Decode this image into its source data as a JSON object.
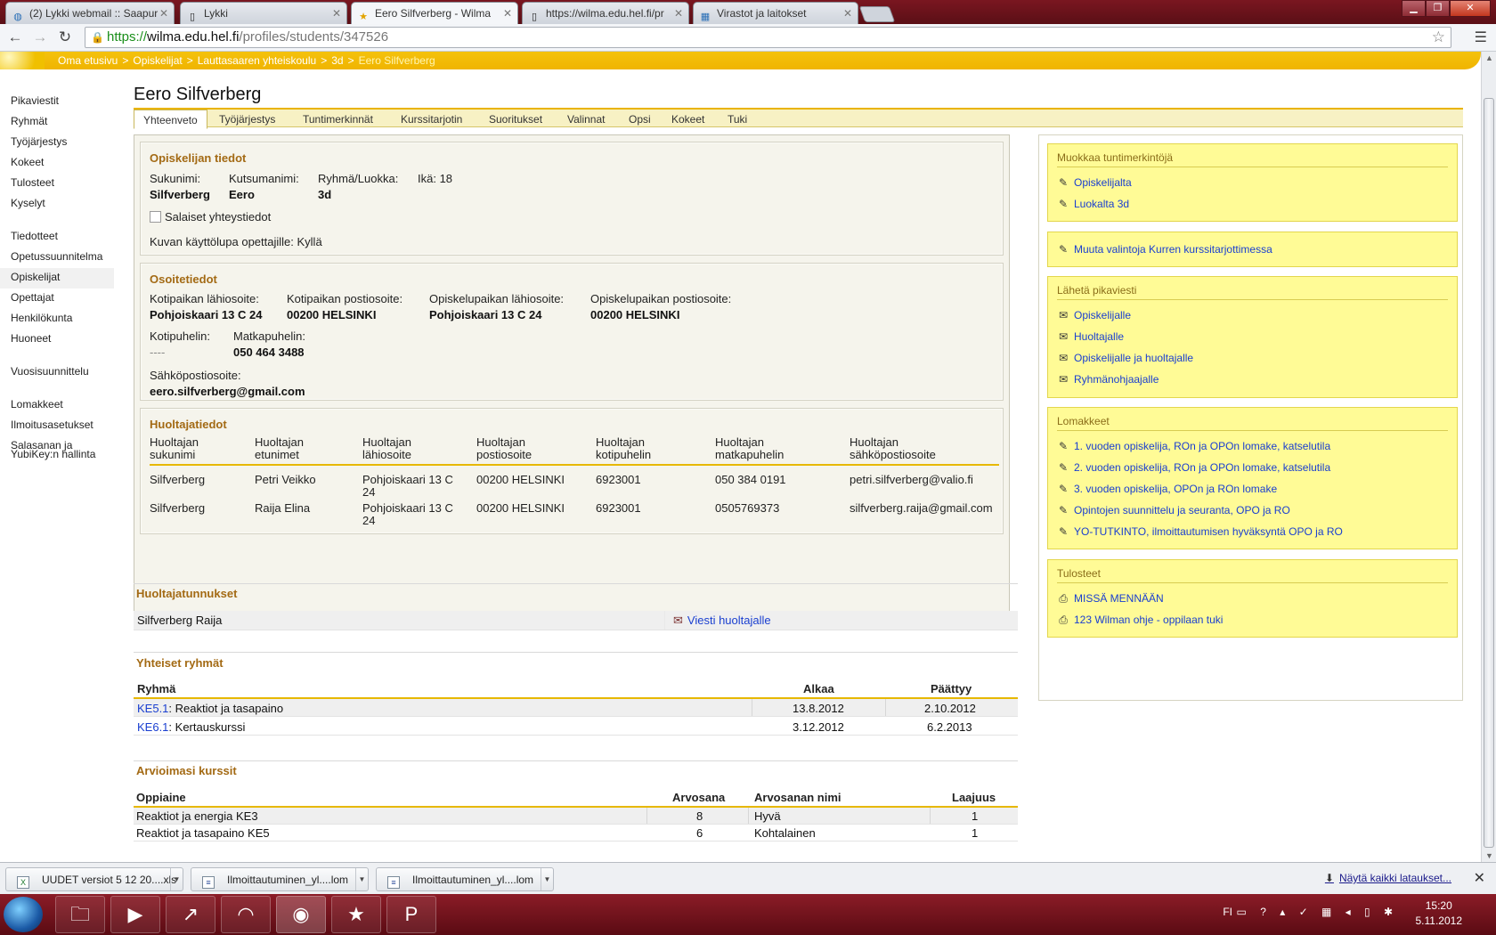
{
  "browser": {
    "tabs": [
      {
        "label": "(2) Lykki webmail :: Saapur",
        "icon": "globe"
      },
      {
        "label": "Lykki",
        "icon": "page"
      },
      {
        "label": "Eero Silfverberg - Wilma",
        "icon": "star"
      },
      {
        "label": "https://wilma.edu.hel.fi/pr",
        "icon": "page"
      },
      {
        "label": "Virastot ja laitokset",
        "icon": "map"
      }
    ],
    "url_scheme": "https://",
    "url_host": "wilma.edu.hel.fi",
    "url_path": "/profiles/students/347526"
  },
  "breadcrumb": [
    "Oma etusivu",
    "Opiskelijat",
    "Lauttasaaren yhteiskoulu",
    "3d",
    "Eero Silfverberg"
  ],
  "sidebar": {
    "groups": [
      [
        "Pikaviestit",
        "Ryhmät",
        "Työjärjestys",
        "Kokeet",
        "Tulosteet",
        "Kyselyt"
      ],
      [
        "Tiedotteet",
        "Opetussuunnitelma",
        "Opiskelijat",
        "Opettajat",
        "Henkilökunta",
        "Huoneet"
      ],
      [
        "Vuosisuunnittelu"
      ],
      [
        "Lomakkeet",
        "Ilmoitusasetukset",
        "Salasanan ja",
        "YubiKey:n hallinta"
      ]
    ]
  },
  "title": "Eero Silfverberg",
  "tabs": [
    "Yhteenveto",
    "Työjärjestys",
    "Tuntimerkinnät",
    "Kurssitarjotin",
    "Suoritukset",
    "Valinnat",
    "Opsi",
    "Kokeet",
    "Tuki"
  ],
  "student": {
    "heading": "Opiskelijan tiedot",
    "surname_label": "Sukunimi:",
    "surname": "Silfverberg",
    "callname_label": "Kutsumanimi:",
    "callname": "Eero",
    "group_label": "Ryhmä/Luokka:",
    "group": "3d",
    "age": "Ikä: 18",
    "secret_contact": "Salaiset yhteystiedot",
    "photo_permission": "Kuvan käyttölupa opettajille: Kyllä"
  },
  "address": {
    "heading": "Osoitetiedot",
    "home_street_label": "Kotipaikan lähiosoite:",
    "home_street": "Pohjoiskaari 13 C 24",
    "home_postal_label": "Kotipaikan postiosoite:",
    "home_postal": "00200 HELSINKI",
    "study_street_label": "Opiskelupaikan lähiosoite:",
    "study_street": "Pohjoiskaari 13 C 24",
    "study_postal_label": "Opiskelupaikan postiosoite:",
    "study_postal": "00200 HELSINKI",
    "home_phone_label": "Kotipuhelin:",
    "home_phone": "----",
    "mobile_label": "Matkapuhelin:",
    "mobile": "050 464 3488",
    "email_label": "Sähköpostiosoite:",
    "email": "eero.silfverberg@gmail.com"
  },
  "guardians": {
    "heading": "Huoltajatiedot",
    "columns": [
      [
        "Huoltajan",
        "sukunimi"
      ],
      [
        "Huoltajan",
        "etunimet"
      ],
      [
        "Huoltajan",
        "lähiosoite"
      ],
      [
        "Huoltajan",
        "postiosoite"
      ],
      [
        "Huoltajan",
        "kotipuhelin"
      ],
      [
        "Huoltajan",
        "matkapuhelin"
      ],
      [
        "Huoltajan",
        "sähköpostiosoite"
      ]
    ],
    "rows": [
      [
        "Silfverberg",
        "Petri Veikko",
        "Pohjoiskaari 13 C",
        "24",
        "00200 HELSINKI",
        "6923001",
        "050 384 0191",
        "petri.silfverberg@valio.fi"
      ],
      [
        "Silfverberg",
        "Raija Elina",
        "Pohjoiskaari 13 C",
        "24",
        "00200 HELSINKI",
        "6923001",
        "0505769373",
        "silfverberg.raija@gmail.com"
      ]
    ]
  },
  "guardian_accounts": {
    "heading": "Huoltajatunnukset",
    "name": "Silfverberg Raija",
    "message_link": "Viesti huoltajalle"
  },
  "common_groups": {
    "heading": "Yhteiset ryhmät",
    "col_group": "Ryhmä",
    "col_start": "Alkaa",
    "col_end": "Päättyy",
    "rows": [
      {
        "code": "KE5.1",
        "name": ": Reaktiot ja tasapaino",
        "start": "13.8.2012",
        "end": "2.10.2012"
      },
      {
        "code": "KE6.1",
        "name": ": Kertauskurssi",
        "start": "3.12.2012",
        "end": "6.2.2013"
      }
    ]
  },
  "graded_courses": {
    "heading": "Arvioimasi kurssit",
    "col_subject": "Oppiaine",
    "col_grade": "Arvosana",
    "col_grade_name": "Arvosanan nimi",
    "col_scope": "Laajuus",
    "rows": [
      {
        "subject": "Reaktiot ja energia KE3",
        "grade": "8",
        "grade_name": "Hyvä",
        "scope": "1"
      },
      {
        "subject": "Reaktiot ja tasapaino KE5",
        "grade": "6",
        "grade_name": "Kohtalainen",
        "scope": "1"
      }
    ]
  },
  "right_panel": {
    "edit_marks": {
      "heading": "Muokkaa tuntimerkintöjä",
      "links": [
        "Opiskelijalta",
        "Luokalta 3d"
      ]
    },
    "change_choices": "Muuta valintoja Kurren kurssitarjottimessa",
    "send_message": {
      "heading": "Lähetä pikaviesti",
      "links": [
        "Opiskelijalle",
        "Huoltajalle",
        "Opiskelijalle ja huoltajalle",
        "Ryhmänohjaajalle"
      ]
    },
    "forms": {
      "heading": "Lomakkeet",
      "links": [
        "1. vuoden opiskelija, ROn ja OPOn lomake, katselutila",
        "2. vuoden opiskelija, ROn ja OPOn lomake, katselutila",
        "3. vuoden opiskelija, OPOn ja ROn lomake",
        "Opintojen suunnittelu ja seuranta, OPO ja RO",
        "YO-TUTKINTO, ilmoittautumisen hyväksyntä OPO ja RO"
      ]
    },
    "printouts": {
      "heading": "Tulosteet",
      "links": [
        "MISSÄ MENNÄÄN",
        "123 Wilman ohje - oppilaan tuki"
      ]
    }
  },
  "downloads": {
    "items": [
      "UUDET versiot 5 12 20....xls",
      "Ilmoittautuminen_yl....lom",
      "Ilmoittautuminen_yl....lom"
    ],
    "show_all": "Näytä kaikki lataukset..."
  },
  "taskbar": {
    "lang": "FI",
    "time": "15:20",
    "date": "5.11.2012"
  },
  "colors": {
    "accent": "#f0b400",
    "panel_yellow": "#fffb96",
    "section_heading": "#a36a14",
    "link": "#1a3fd0",
    "taskbar": "#7a1620"
  }
}
